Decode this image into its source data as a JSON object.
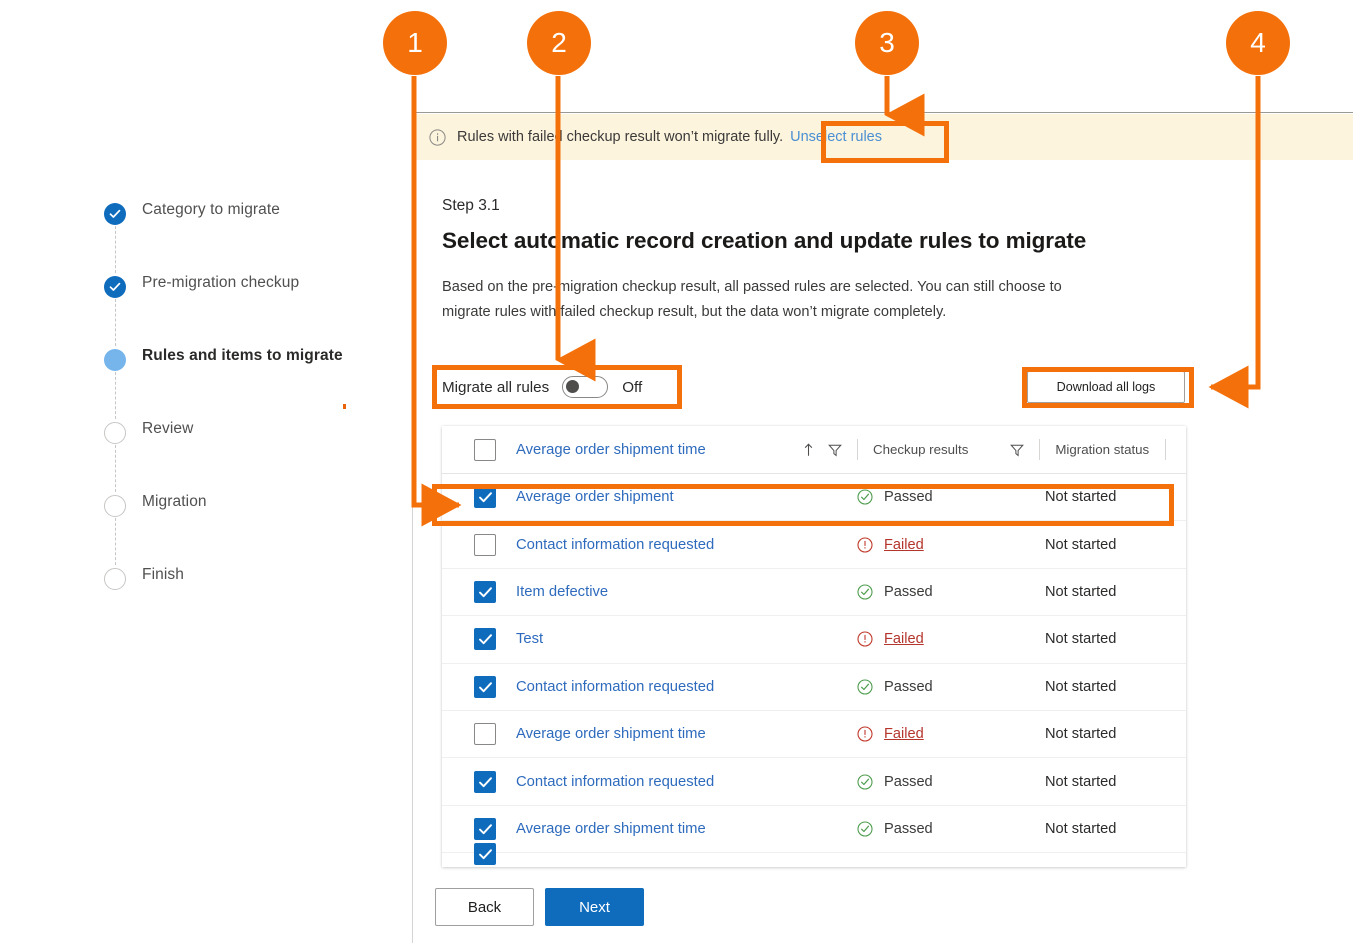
{
  "wizard": {
    "steps": [
      {
        "label": "Category to migrate",
        "state": "done",
        "icon": "check-icon"
      },
      {
        "label": "Pre-migration checkup",
        "state": "done",
        "icon": "check-icon"
      },
      {
        "label": "Rules and items to migrate",
        "state": "current",
        "icon": "filled-dot-icon"
      },
      {
        "label": "Review",
        "state": "todo",
        "icon": "empty-circle-icon"
      },
      {
        "label": "Migration",
        "state": "todo",
        "icon": "empty-circle-icon"
      },
      {
        "label": "Finish",
        "state": "todo",
        "icon": "empty-circle-icon"
      }
    ]
  },
  "banner": {
    "icon": "info-icon",
    "text": "Rules with failed checkup result won’t migrate fully.",
    "link_label": "Unselect rules",
    "background": "#fcf4dd",
    "link_color": "#4a8fd4"
  },
  "page": {
    "eyebrow": "Step 3.1",
    "title": "Select automatic record creation and update rules to migrate",
    "description": "Based on the pre-migration checkup result, all passed rules are selected. You can still choose to migrate rules with failed checkup result, but the data won’t migrate completely."
  },
  "toggle": {
    "label": "Migrate all rules",
    "state": "Off",
    "checked": false
  },
  "download_logs": {
    "label": "Download all logs"
  },
  "table": {
    "header": {
      "name_column": "Average order shipment time",
      "sort_icon": "sort-ascending-icon",
      "name_filter_icon": "filter-icon",
      "checkup_column": "Checkup results",
      "checkup_filter_icon": "filter-icon",
      "status_column": "Migration status",
      "header_checkbox_checked": false
    },
    "rows": [
      {
        "checked": true,
        "name": "Average order shipment",
        "checkup": "Passed",
        "status": "Not started",
        "highlighted": true
      },
      {
        "checked": false,
        "name": "Contact information requested",
        "checkup": "Failed",
        "status": "Not started",
        "highlighted": false
      },
      {
        "checked": true,
        "name": "Item defective",
        "checkup": "Passed",
        "status": "Not started",
        "highlighted": false
      },
      {
        "checked": true,
        "name": "Test",
        "checkup": "Failed",
        "status": "Not started",
        "highlighted": false
      },
      {
        "checked": true,
        "name": "Contact information requested",
        "checkup": "Passed",
        "status": "Not started",
        "highlighted": false
      },
      {
        "checked": false,
        "name": "Average order shipment time",
        "checkup": "Failed",
        "status": "Not started",
        "highlighted": false
      },
      {
        "checked": true,
        "name": "Contact information requested",
        "checkup": "Passed",
        "status": "Not started",
        "highlighted": false
      },
      {
        "checked": true,
        "name": "Average order shipment time",
        "checkup": "Passed",
        "status": "Not started",
        "highlighted": false
      },
      {
        "checked": true,
        "name": "",
        "checkup": "",
        "status": "",
        "highlighted": false,
        "partial": true
      }
    ],
    "status_colors": {
      "passed": "#3b8a3b",
      "failed": "#c0392b"
    }
  },
  "footer": {
    "back_label": "Back",
    "next_label": "Next",
    "primary_color": "#0f6cbd"
  },
  "annotations": {
    "accent_color": "#f4700a",
    "callouts": [
      {
        "number": "1",
        "target": "selected-rule-row"
      },
      {
        "number": "2",
        "target": "migrate-all-rules-toggle"
      },
      {
        "number": "3",
        "target": "unselect-rules-link"
      },
      {
        "number": "4",
        "target": "download-all-logs-button"
      }
    ]
  }
}
